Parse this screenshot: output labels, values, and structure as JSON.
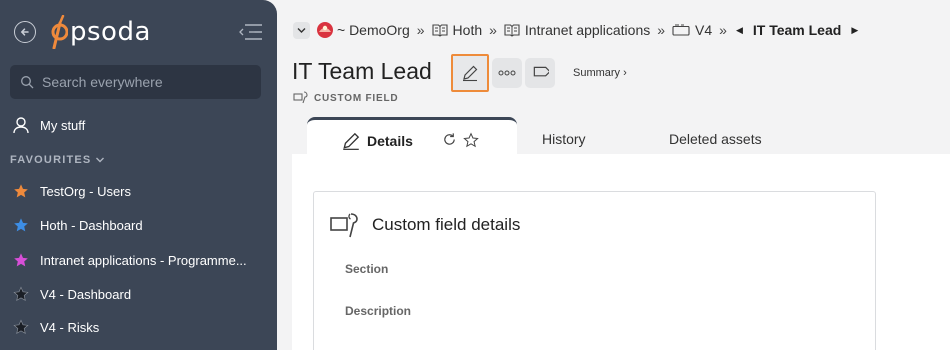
{
  "sidebar": {
    "logo_text": "psoda",
    "search_placeholder": "Search everywhere",
    "my_stuff_label": "My stuff",
    "favourites_heading": "FAVOURITES",
    "favourites": [
      {
        "label": "TestOrg - Users",
        "star_color": "#ef8a3c"
      },
      {
        "label": "Hoth - Dashboard",
        "star_color": "#3d8ee6"
      },
      {
        "label": "Intranet applications - Programme...",
        "star_color": "#d84fd8"
      },
      {
        "label": "V4 - Dashboard",
        "star_color": "#1b1f26"
      },
      {
        "label": "V4 - Risks",
        "star_color": "#1b1f26"
      }
    ]
  },
  "breadcrumb": {
    "org": "~ DemoOrg",
    "items": [
      "Hoth",
      "Intranet applications",
      "V4"
    ],
    "current": "IT Team Lead",
    "separator": "»"
  },
  "page": {
    "title": "IT Team Lead",
    "summary_link": "Summary ›",
    "subtype": "CUSTOM FIELD"
  },
  "tabs": {
    "details": "Details",
    "history": "History",
    "deleted": "Deleted assets"
  },
  "card": {
    "title": "Custom field details",
    "fields": [
      "Section",
      "Description"
    ]
  },
  "colors": {
    "sidebar_bg": "#3c4656",
    "accent_orange": "#ee8b3a"
  }
}
